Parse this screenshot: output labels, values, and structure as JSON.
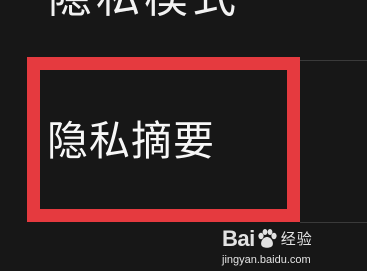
{
  "header": {
    "title": "隐私模式"
  },
  "menu": {
    "item_label": "隐私摘要"
  },
  "highlight": {
    "color": "#e53a3f"
  },
  "watermark": {
    "brand_prefix": "Bai",
    "brand_suffix": "经验",
    "url": "jingyan.baidu.com"
  }
}
